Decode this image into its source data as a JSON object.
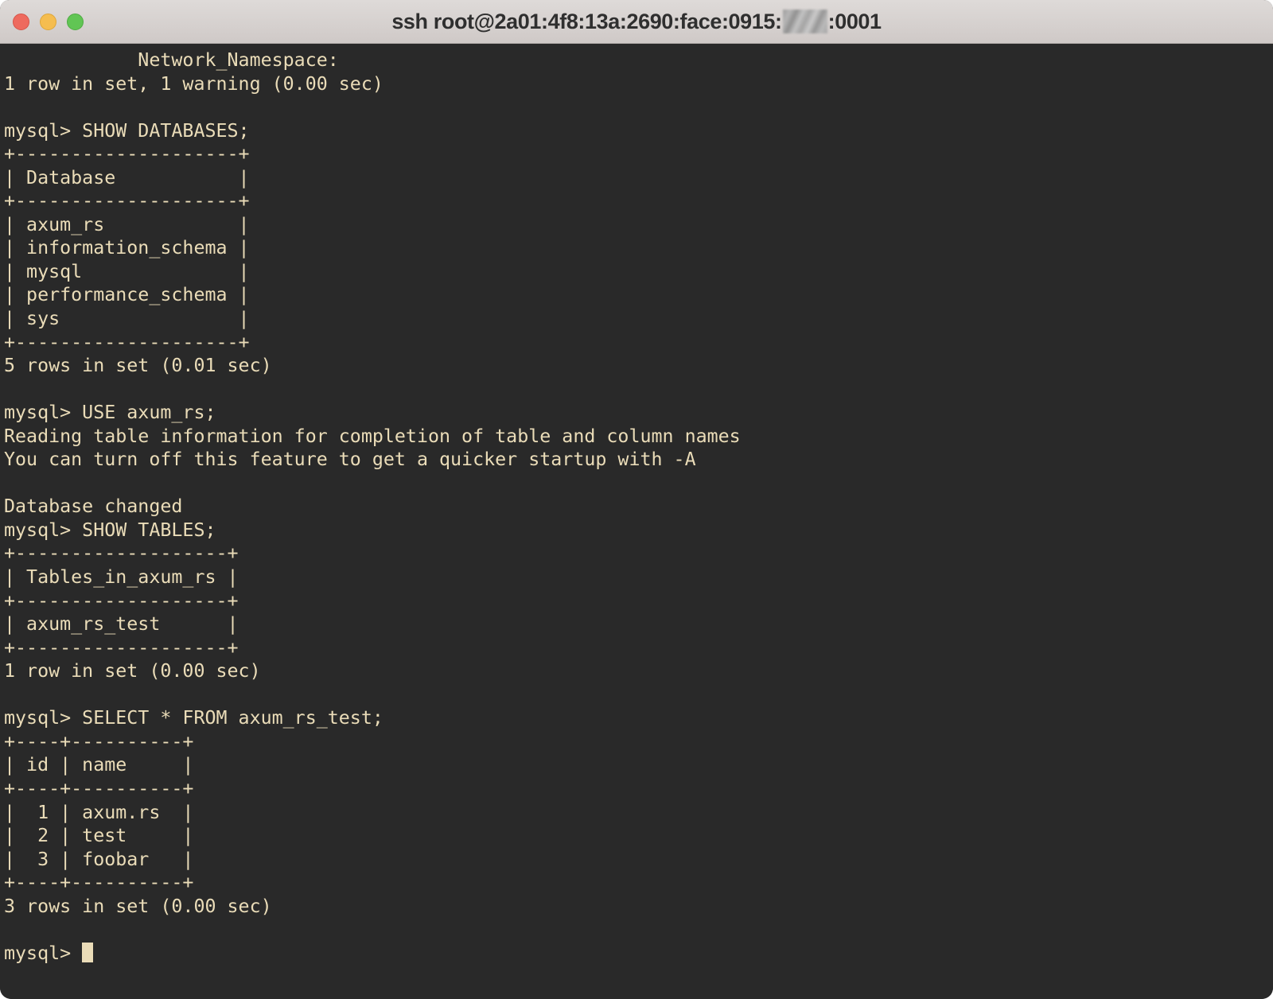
{
  "window": {
    "title_prefix": "ssh root@2a01:4f8:13a:2690:face:0915:",
    "title_suffix": ":0001",
    "title_full": "ssh root@2a01:4f8:13a:2690:face:0915:[redacted]:0001",
    "controls": {
      "close_label": "close",
      "minimize_label": "minimize",
      "maximize_label": "maximize"
    },
    "colors": {
      "titlebar_bg": "#D6D1CF",
      "terminal_bg": "#292929",
      "text_fg": "#EADCB8",
      "close": "#EE6A5E",
      "minimize": "#F5BD4F",
      "maximize": "#61C554"
    }
  },
  "terminal": {
    "prompt": "mysql> ",
    "cursor_visible": true,
    "lines": [
      "            Network_Namespace: ",
      "1 row in set, 1 warning (0.00 sec)",
      "",
      "mysql> SHOW DATABASES;",
      "+--------------------+",
      "| Database           |",
      "+--------------------+",
      "| axum_rs            |",
      "| information_schema |",
      "| mysql              |",
      "| performance_schema |",
      "| sys                |",
      "+--------------------+",
      "5 rows in set (0.01 sec)",
      "",
      "mysql> USE axum_rs;",
      "Reading table information for completion of table and column names",
      "You can turn off this feature to get a quicker startup with -A",
      "",
      "Database changed",
      "mysql> SHOW TABLES;",
      "+-------------------+",
      "| Tables_in_axum_rs |",
      "+-------------------+",
      "| axum_rs_test      |",
      "+-------------------+",
      "1 row in set (0.00 sec)",
      "",
      "mysql> SELECT * FROM axum_rs_test;",
      "+----+----------+",
      "| id | name     |",
      "+----+----------+",
      "|  1 | axum.rs  |",
      "|  2 | test     |",
      "|  3 | foobar   |",
      "+----+----------+",
      "3 rows in set (0.00 sec)",
      ""
    ],
    "tables": [
      {
        "name": "databases-table",
        "columns": [
          "Database"
        ],
        "rows": [
          [
            "axum_rs"
          ],
          [
            "information_schema"
          ],
          [
            "mysql"
          ],
          [
            "performance_schema"
          ],
          [
            "sys"
          ]
        ],
        "footer": "5 rows in set (0.01 sec)"
      },
      {
        "name": "tables-table",
        "columns": [
          "Tables_in_axum_rs"
        ],
        "rows": [
          [
            "axum_rs_test"
          ]
        ],
        "footer": "1 row in set (0.00 sec)"
      },
      {
        "name": "select-result-table",
        "columns": [
          "id",
          "name"
        ],
        "rows": [
          [
            "1",
            "axum.rs"
          ],
          [
            "2",
            "test"
          ],
          [
            "3",
            "foobar"
          ]
        ],
        "footer": "3 rows in set (0.00 sec)"
      }
    ],
    "commands": [
      "SHOW DATABASES;",
      "USE axum_rs;",
      "SHOW TABLES;",
      "SELECT * FROM axum_rs_test;"
    ],
    "messages": [
      "Reading table information for completion of table and column names",
      "You can turn off this feature to get a quicker startup with -A",
      "Database changed",
      "1 row in set, 1 warning (0.00 sec)"
    ]
  }
}
